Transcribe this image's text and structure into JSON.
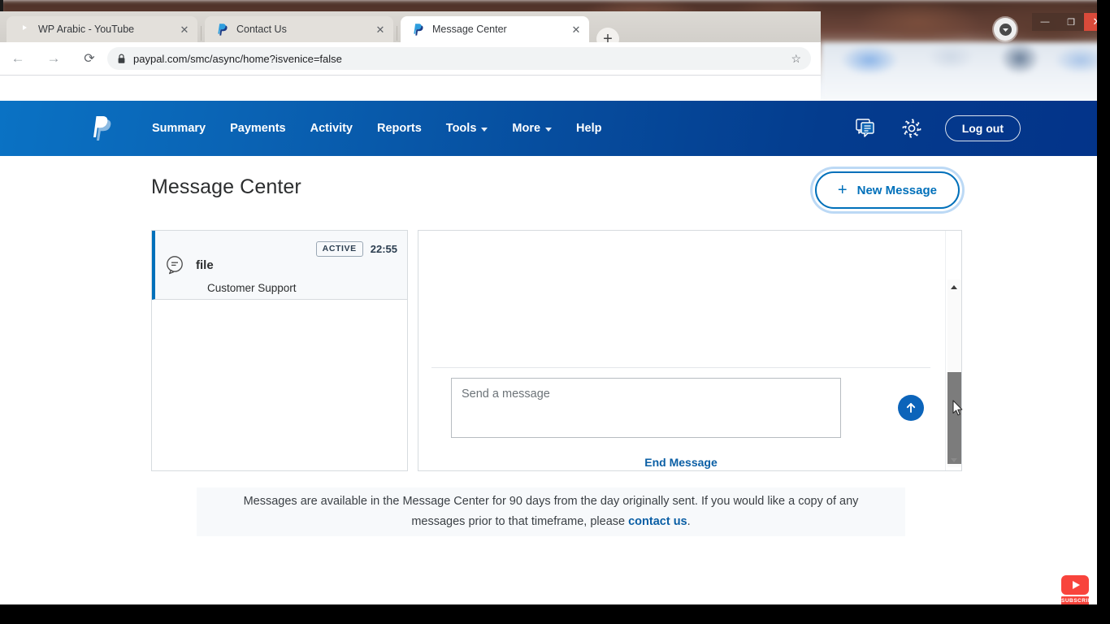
{
  "browser": {
    "tabs": [
      {
        "title": "WP Arabic - YouTube",
        "favicon": "youtube-icon",
        "active": false,
        "close_label": "✕"
      },
      {
        "title": "Contact Us",
        "favicon": "paypal-icon",
        "active": false,
        "close_label": "✕"
      },
      {
        "title": "Message Center",
        "favicon": "paypal-icon",
        "active": true,
        "close_label": "✕"
      }
    ],
    "new_tab_label": "+",
    "back_icon": "←",
    "forward_icon": "→",
    "reload_icon": "⟳",
    "url": "paypal.com/smc/async/home?isvenice=false",
    "lock_icon": "lock-icon",
    "bookmark_icon": "☆",
    "window_controls": {
      "minimize": "—",
      "maximize": "❐",
      "close": "✕"
    },
    "profile_icon": "profile-avatar-icon"
  },
  "paypal_nav": {
    "logo": "paypal-logo-icon",
    "links": [
      {
        "label": "Summary",
        "has_caret": false
      },
      {
        "label": "Payments",
        "has_caret": false
      },
      {
        "label": "Activity",
        "has_caret": false
      },
      {
        "label": "Reports",
        "has_caret": false
      },
      {
        "label": "Tools",
        "has_caret": true
      },
      {
        "label": "More",
        "has_caret": true
      },
      {
        "label": "Help",
        "has_caret": false
      }
    ],
    "messages_icon": "messages-icon",
    "settings_icon": "gear-icon",
    "logout_label": "Log out"
  },
  "main": {
    "page_title": "Message Center",
    "new_message_label": "New Message",
    "new_message_plus": "+",
    "conversations": [
      {
        "name": "file",
        "subtitle": "Customer Support",
        "status_badge": "ACTIVE",
        "time": "22:55",
        "icon": "message-bubble-icon",
        "selected": true
      }
    ],
    "compose": {
      "placeholder": "Send a message",
      "value": "",
      "send_icon": "arrow-up-icon",
      "end_message_label": "End Message"
    },
    "footnote": {
      "text_before": "Messages are available in the Message Center for 90 days from the day originally sent. If you would like a copy of any messages prior to that timeframe, please ",
      "link_text": "contact us",
      "text_after": "."
    }
  },
  "overlay": {
    "subscribe_label": "SUBSCRIBE",
    "youtube_icon": "youtube-play-icon"
  },
  "colors": {
    "paypal_blue": "#0070ba",
    "nav_gradient_start": "#0a72c4",
    "nav_gradient_end": "#033389",
    "link_blue": "#0b5fa5",
    "selected_accent": "#0070ba",
    "youtube_red": "#f8443c",
    "close_button_red": "#d94a3a"
  }
}
